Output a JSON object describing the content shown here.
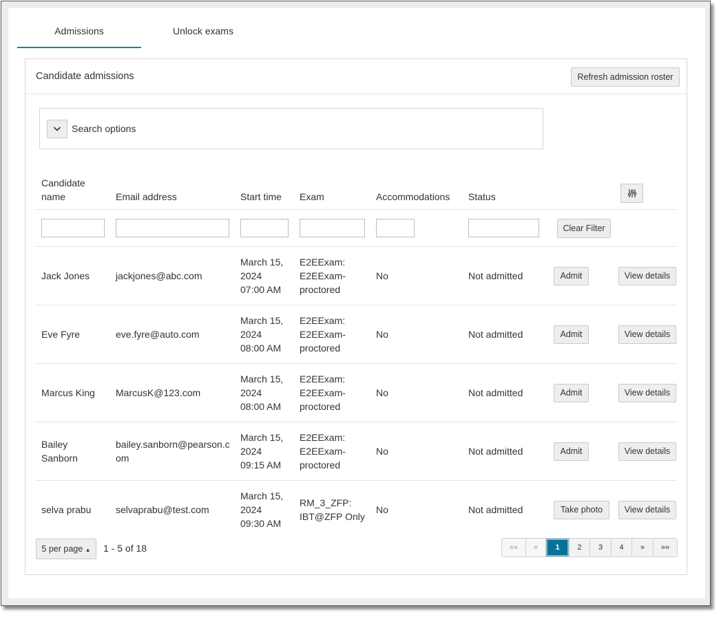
{
  "tabs": [
    {
      "label": "Admissions",
      "active": true
    },
    {
      "label": "Unlock exams",
      "active": false
    }
  ],
  "panel": {
    "title": "Candidate admissions",
    "refresh_label": "Refresh admission roster"
  },
  "search": {
    "label": "Search options",
    "icon": "chevron-down-icon"
  },
  "table": {
    "headers": {
      "name_line1": "Candidate",
      "name_line2": "name",
      "email": "Email address",
      "start": "Start time",
      "exam": "Exam",
      "accommodations": "Accommodations",
      "status": "Status"
    },
    "column_settings_icon": "sliders-icon",
    "clear_filter_label": "Clear Filter",
    "rows": [
      {
        "name": [
          "Jack Jones"
        ],
        "email": "jackjones@abc.com",
        "start": [
          "March 15,",
          "2024",
          "07:00 AM"
        ],
        "exam": [
          "E2EExam:",
          "E2EExam-",
          "proctored"
        ],
        "accommodations": "No",
        "status": "Not admitted",
        "action": "Admit",
        "details": "View details"
      },
      {
        "name": [
          "Eve Fyre"
        ],
        "email": "eve.fyre@auto.com",
        "start": [
          "March 15,",
          "2024",
          "08:00 AM"
        ],
        "exam": [
          "E2EExam:",
          "E2EExam-",
          "proctored"
        ],
        "accommodations": "No",
        "status": "Not admitted",
        "action": "Admit",
        "details": "View details"
      },
      {
        "name": [
          "Marcus King"
        ],
        "email": "MarcusK@123.com",
        "start": [
          "March 15,",
          "2024",
          "08:00 AM"
        ],
        "exam": [
          "E2EExam:",
          "E2EExam-",
          "proctored"
        ],
        "accommodations": "No",
        "status": "Not admitted",
        "action": "Admit",
        "details": "View details"
      },
      {
        "name": [
          "Bailey",
          "Sanborn"
        ],
        "email": "bailey.sanborn@pearson.com",
        "start": [
          "March 15,",
          "2024",
          "09:15 AM"
        ],
        "exam": [
          "E2EExam:",
          "E2EExam-",
          "proctored"
        ],
        "accommodations": "No",
        "status": "Not admitted",
        "action": "Admit",
        "details": "View details"
      },
      {
        "name": [
          "selva prabu"
        ],
        "email": "selvaprabu@test.com",
        "start": [
          "March 15,",
          "2024",
          "09:30 AM"
        ],
        "exam": [
          "RM_3_ZFP:",
          "IBT@ZFP Only"
        ],
        "accommodations": "No",
        "status": "Not admitted",
        "action": "Take photo",
        "details": "View details"
      }
    ]
  },
  "footer": {
    "per_page_label": "5 per page",
    "range_text": "1 - 5 of 18",
    "pager": {
      "first": "««",
      "prev": "«",
      "pages": [
        "1",
        "2",
        "3",
        "4"
      ],
      "current": "1",
      "next": "»",
      "last": "»»"
    }
  },
  "colors": {
    "accent": "#0a7199",
    "tab_underline": "#1a7fa3"
  }
}
